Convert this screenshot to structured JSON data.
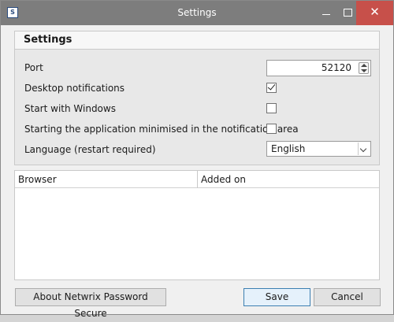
{
  "window": {
    "title": "Settings",
    "app_icon": "netwrix-app-icon",
    "controls": {
      "minimize": "minimize-icon",
      "maximize": "maximize-icon",
      "close": "✕"
    },
    "close_color": "#c7504a",
    "titlebar_color": "#7d7d7d"
  },
  "settings": {
    "group_title": "Settings",
    "port": {
      "label": "Port",
      "value": "52120"
    },
    "desktop_notifications": {
      "label": "Desktop notifications",
      "checked": true
    },
    "start_with_windows": {
      "label": "Start with Windows",
      "checked": false
    },
    "start_minimised": {
      "label": "Starting the application minimised in the notification area",
      "checked": false
    },
    "language": {
      "label": "Language (restart required)",
      "value": "English"
    }
  },
  "browser_table": {
    "columns": [
      "Browser",
      "Added on"
    ],
    "rows": []
  },
  "buttons": {
    "about": "About Netwrix Password Secure",
    "save": "Save",
    "cancel": "Cancel"
  },
  "accent_color": "#3c7fb1"
}
